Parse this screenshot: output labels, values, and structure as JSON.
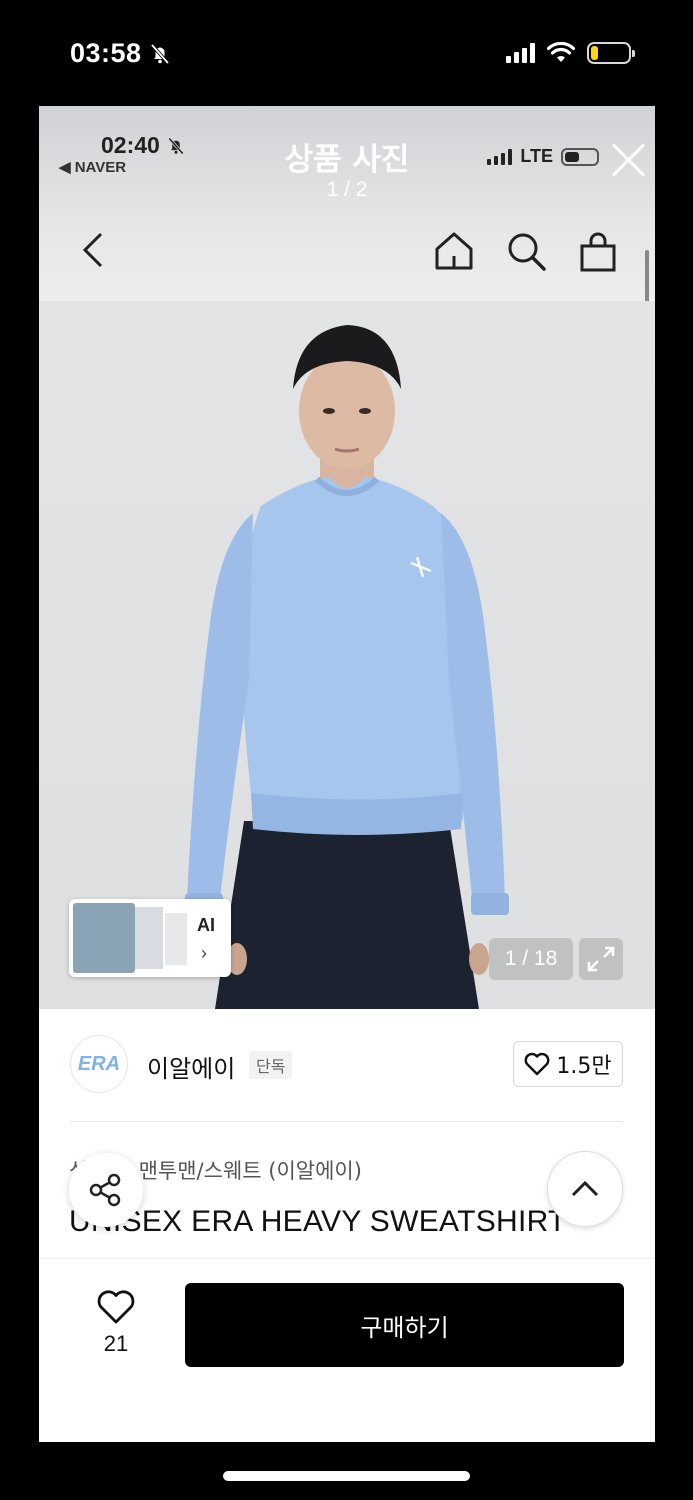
{
  "outer_status": {
    "time": "03:58",
    "bell_icon": "bell-slash-icon",
    "signal_bars": 4,
    "wifi_icon": "wifi-icon",
    "battery_level": 0.2,
    "battery_color": "#ffd60a"
  },
  "inner_status": {
    "time": "02:40",
    "back_app": "◀ NAVER",
    "network": "LTE",
    "battery_level": 0.45
  },
  "viewer": {
    "title": "상품 사진",
    "page_indicator": "1 / 2",
    "close_icon": "close-icon"
  },
  "nav": {
    "back_icon": "chevron-left-icon",
    "home_icon": "home-icon",
    "search_icon": "search-icon",
    "cart_icon": "shopping-bag-icon"
  },
  "photo": {
    "thumb_label": "AI",
    "thumb_chevron": "›",
    "page_counter": "1 / 18",
    "expand_icon": "expand-icon",
    "sweatshirt_color": "#a7c6ee"
  },
  "brand": {
    "logo_text": "ERA",
    "name": "이알에이",
    "tag": "단독",
    "likes": "1.5만"
  },
  "product": {
    "category": "상의 > 맨투맨/스웨트 (이알에이)",
    "title": "UNISEX ERA HEAVY SWEATSHIRT"
  },
  "floating": {
    "share_icon": "share-icon",
    "top_icon": "chevron-up-icon"
  },
  "bottom_bar": {
    "wish_count": "21",
    "buy_label": "구매하기"
  }
}
